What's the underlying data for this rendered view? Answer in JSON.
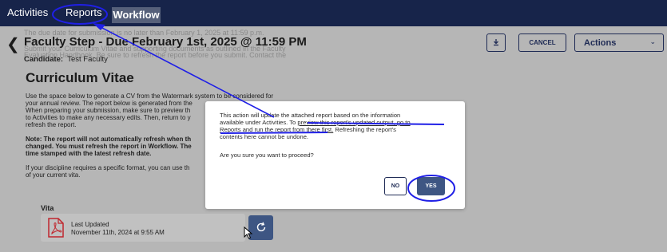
{
  "nav": {
    "activities": "Activities",
    "reports": "Reports",
    "workflow": "Workflow"
  },
  "header": {
    "faded_line_1": "The due date for submission is no later than February 1, 2025 at 11:59 p.m.",
    "faded_line_2": "Submit your Curriculum Vitae and supporting documents as outlined in the Faculty",
    "faded_line_3": "Evaluation Handbook. Be sure to refresh the report before you submit. Contact the",
    "title": "Faculty Step - Due February 1st, 2025 @ 11:59 PM",
    "candidate_label": "Candidate:",
    "candidate_name": "Test Faculty",
    "download_icon": "download-icon",
    "cancel": "CANCEL",
    "actions": "Actions"
  },
  "content": {
    "section_title": "Curriculum Vitae",
    "para1": [
      "Use the space below to generate a CV from the Watermark system to be considered for",
      "your annual review. The report below is generated from the",
      "When preparing your submission, make sure to preview th",
      "to Activities to make any necessary edits. Then, return to y",
      "refresh the report."
    ],
    "para2": [
      "Note: The report will not automatically refresh when th",
      "changed. You must refresh the report in Workflow. The",
      "time stamped with the latest refresh date."
    ],
    "para3": [
      "If your discipline requires a specific format, you can use th",
      "of your current vita."
    ],
    "vita_label": "Vita",
    "vita_last_updated": "Last Updated",
    "vita_date": "November 11th, 2024 at 9:55 AM"
  },
  "modal": {
    "line1": "This action will update the attached report based on the information",
    "line2_a": "available under Activities. To ",
    "line2_b": "preview this report's updated output, go to",
    "line3_a": "Reports and run the report from there first.",
    "line3_b": " Refreshing the report's",
    "line4": "contents here cannot be undone.",
    "question": "Are you sure you want to proceed?",
    "no": "NO",
    "yes": "YES"
  },
  "colors": {
    "nav_bg": "#17244a",
    "primary_button": "#3e5683",
    "annotation_blue": "#1f1fe6",
    "overlay_bg": "#b6b6b6"
  }
}
